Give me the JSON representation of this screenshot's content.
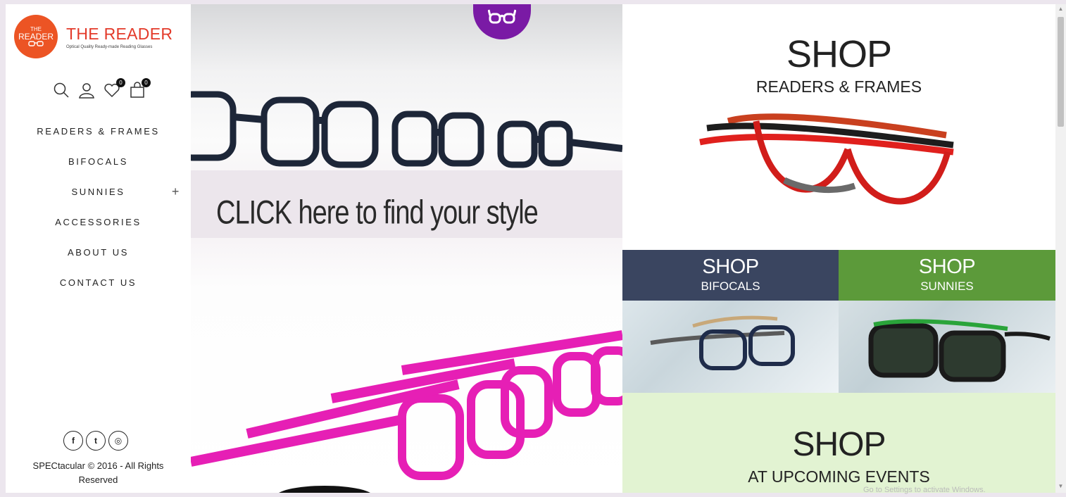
{
  "brand": {
    "badge_small": "THE",
    "badge_big": "READER",
    "name": "THE READER",
    "tagline": "Optical Quality Ready-made Reading Glasses"
  },
  "header_icons": {
    "search": "search-icon",
    "account": "user-icon",
    "wishlist_count": "0",
    "cart_count": "0"
  },
  "nav": {
    "items": [
      {
        "label": "READERS & FRAMES"
      },
      {
        "label": "BIFOCALS"
      },
      {
        "label": "SUNNIES",
        "expand": "+"
      },
      {
        "label": "ACCESSORIES"
      },
      {
        "label": "ABOUT US"
      },
      {
        "label": "CONTACT US"
      }
    ]
  },
  "social": {
    "facebook": "f",
    "twitter": "t",
    "instagram": "◎"
  },
  "footer": {
    "copyright": "SPECtacular © 2016 - All Rights Reserved"
  },
  "hero": {
    "caption": "CLICK here to find your style"
  },
  "tiles": {
    "readers": {
      "title": "SHOP",
      "sub": "READERS & FRAMES"
    },
    "bifocals": {
      "title": "SHOP",
      "sub": "BIFOCALS"
    },
    "sunnies": {
      "title": "SHOP",
      "sub": "SUNNIES"
    },
    "events": {
      "title": "SHOP",
      "sub": "AT UPCOMING EVENTS"
    }
  },
  "os_notice": "Go to Settings to activate Windows.",
  "colors": {
    "brand_red": "#e33a2a",
    "purple": "#7a1aa5",
    "navy": "#3a4560",
    "green": "#5c9a3a",
    "mint": "#e2f3d2"
  }
}
